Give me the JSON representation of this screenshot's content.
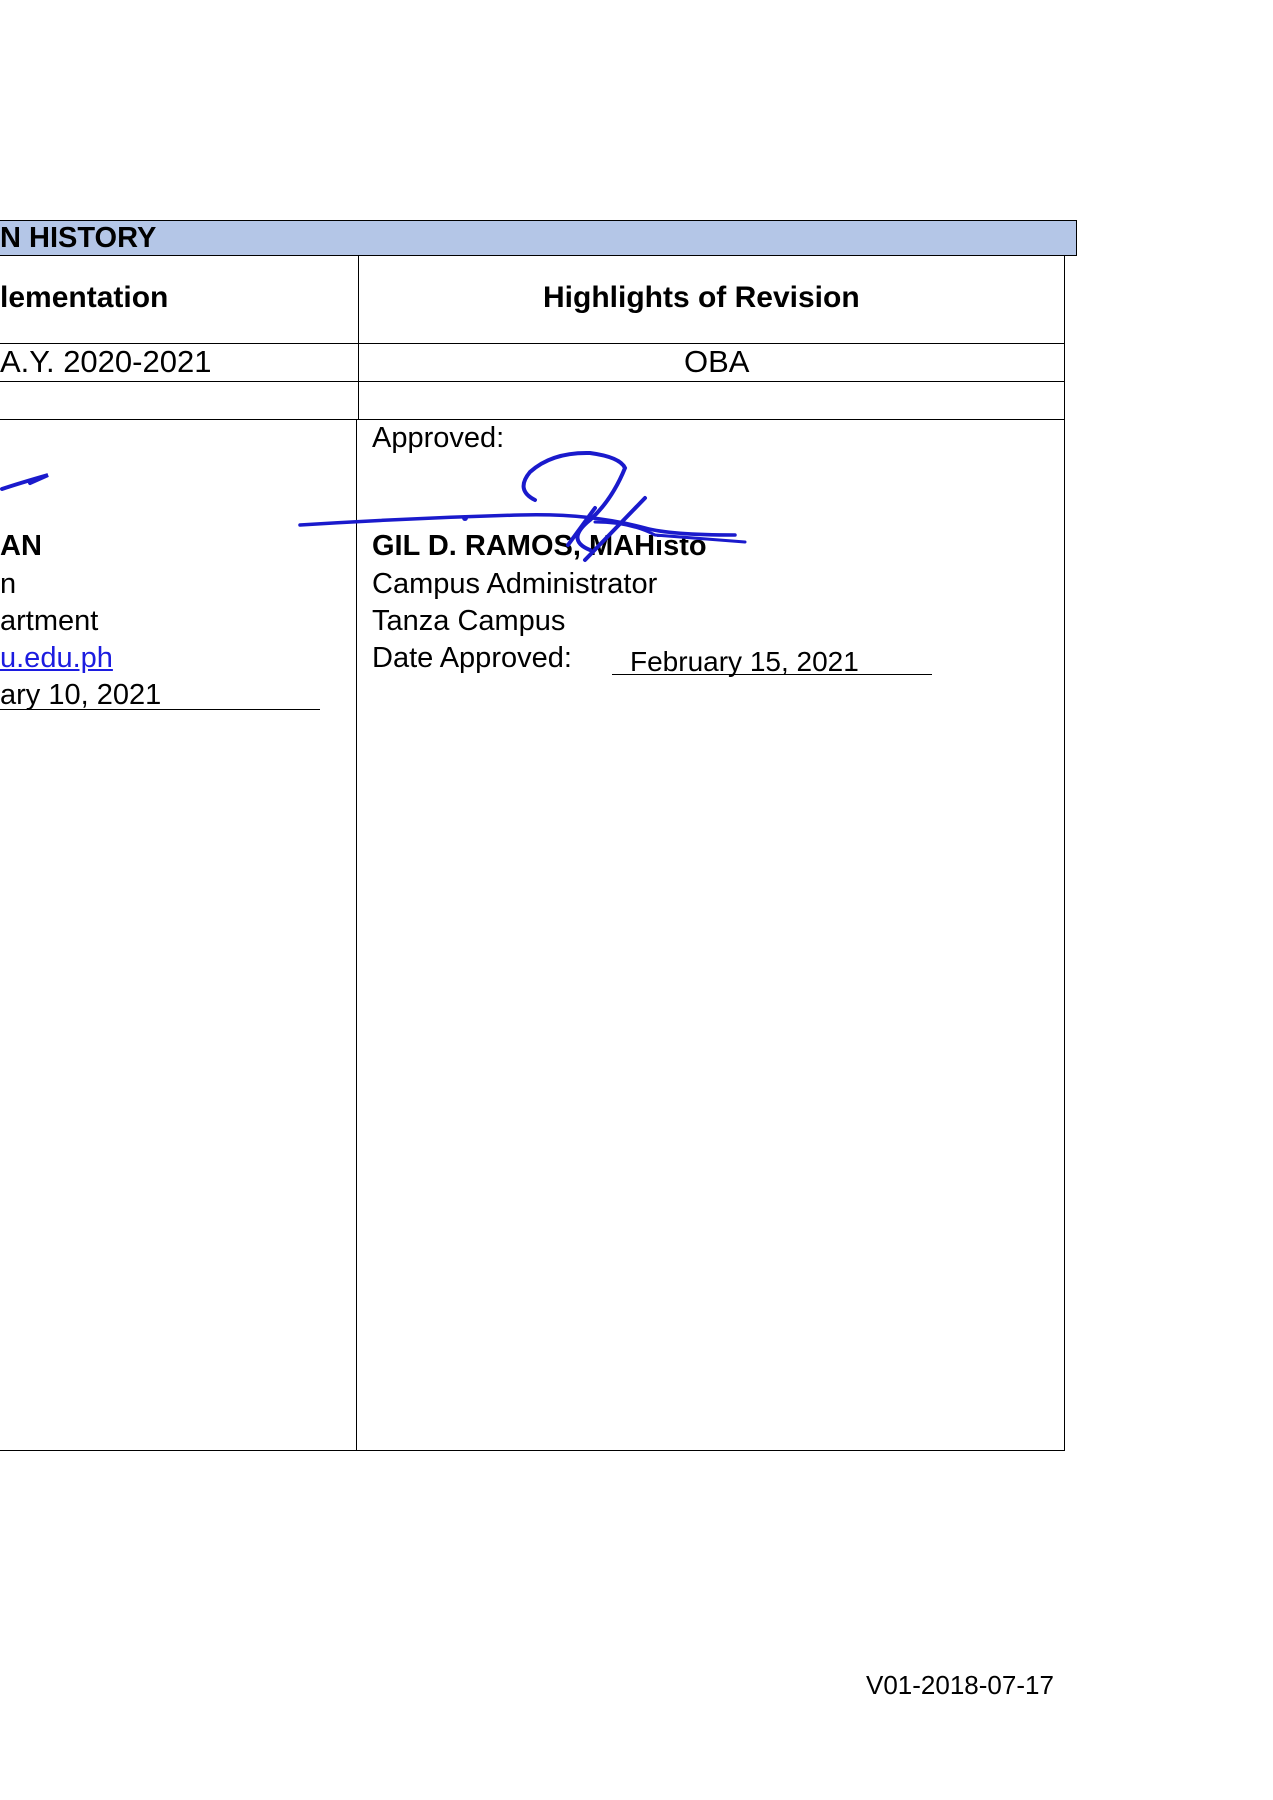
{
  "revision_table": {
    "section_title": "N HISTORY",
    "columns": {
      "implementation": "lementation",
      "highlights": "Highlights of Revision"
    },
    "rows": [
      {
        "implementation": "A.Y. 2020-2021",
        "highlights": "OBA"
      },
      {
        "implementation": "",
        "highlights": ""
      }
    ]
  },
  "prepared_by": {
    "name_fragment": "AN",
    "position_fragment": "n",
    "department_fragment": "artment",
    "email_fragment": "u.edu.ph",
    "date_fragment": "ary 10, 2021"
  },
  "approved_by": {
    "label": "Approved:",
    "name": "GIL D. RAMOS, MAHisto",
    "position": "Campus Administrator",
    "campus": "Tanza Campus",
    "date_label": "Date Approved:",
    "date_value": "February 15, 2021"
  },
  "signature": {
    "color": "#1a1acc",
    "type": "handwritten-signature"
  },
  "footer": {
    "version_code": "V01-2018-07-17"
  }
}
